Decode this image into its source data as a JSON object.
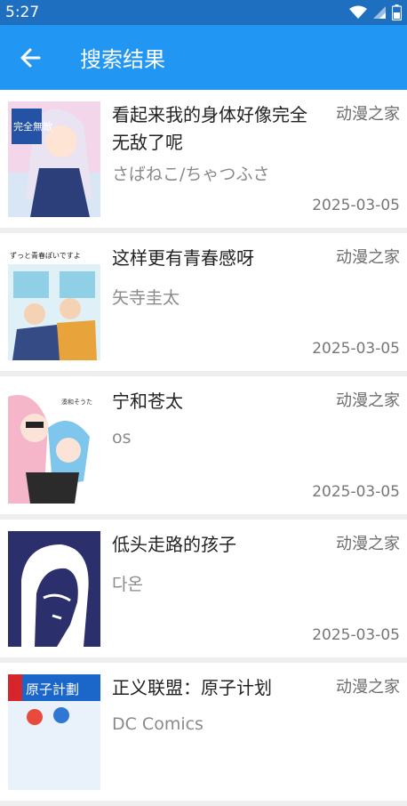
{
  "status": {
    "time": "5:27"
  },
  "appbar": {
    "title": "搜索结果",
    "back_icon": "arrow-left-icon"
  },
  "results": [
    {
      "title": "看起来我的身体好像完全无敌了呢",
      "author": "さばねこ/ちゃつふさ",
      "source": "动漫之家",
      "date": "2025-03-05",
      "cover_text": "完全無敵"
    },
    {
      "title": "这样更有青春感呀",
      "author": "矢寺圭太",
      "source": "动漫之家",
      "date": "2025-03-05",
      "cover_text": "ずっと青春ぽいですよ"
    },
    {
      "title": "宁和苍太",
      "author": "os",
      "source": "动漫之家",
      "date": "2025-03-05",
      "cover_text": ""
    },
    {
      "title": "低头走路的孩子",
      "author": "다온",
      "source": "动漫之家",
      "date": "2025-03-05",
      "cover_text": ""
    },
    {
      "title": "正义联盟：原子计划",
      "author": "DC Comics",
      "source": "动漫之家",
      "date": "",
      "cover_text": "原子計劃"
    }
  ],
  "colors": {
    "appbar": "#2196f3",
    "statusbar": "#1e6fbf",
    "background": "#eeeeee"
  }
}
